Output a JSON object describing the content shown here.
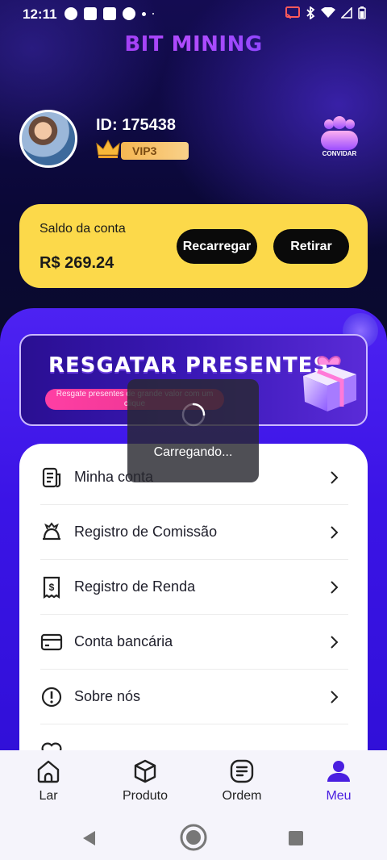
{
  "status_bar": {
    "time": "12:11"
  },
  "app": {
    "title": "BIT MINING"
  },
  "profile": {
    "id_text": "ID: 175438",
    "vip_level": "VIP3",
    "invite_label": "CONVIDAR"
  },
  "balance": {
    "label": "Saldo da conta",
    "value": "R$ 269.24",
    "recharge_label": "Recarregar",
    "withdraw_label": "Retirar"
  },
  "banner": {
    "title": "RESGATAR PRESENTES",
    "subtitle": "Resgate presentes de grande valor com um clique"
  },
  "menu": {
    "items": [
      {
        "label": "Minha conta",
        "icon": "account-document-icon"
      },
      {
        "label": "Registro de Comissão",
        "icon": "commission-icon"
      },
      {
        "label": "Registro de Renda",
        "icon": "income-receipt-icon"
      },
      {
        "label": "Conta bancária",
        "icon": "bank-card-icon"
      },
      {
        "label": "Sobre nós",
        "icon": "info-icon"
      }
    ]
  },
  "loading": {
    "text": "Carregando..."
  },
  "bottom_nav": {
    "items": [
      {
        "label": "Lar",
        "icon": "home-icon"
      },
      {
        "label": "Produto",
        "icon": "cube-icon"
      },
      {
        "label": "Ordem",
        "icon": "order-list-icon"
      },
      {
        "label": "Meu",
        "icon": "user-icon",
        "active": true
      }
    ]
  },
  "colors": {
    "accent": "#4a1fe0",
    "balance_card": "#fcd94a",
    "panel": "#3b14e6"
  }
}
